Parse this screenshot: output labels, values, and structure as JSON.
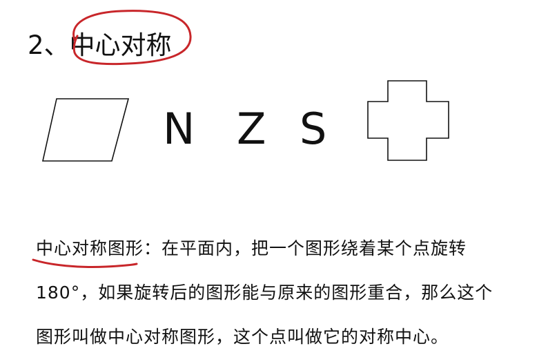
{
  "heading": {
    "number": "2、",
    "title": "中心对称"
  },
  "figures": {
    "letters": [
      "N",
      "Z",
      "S"
    ]
  },
  "definition": {
    "lines": [
      "中心对称图形：在平面内，把一个图形绕着某个点旋转",
      "180°，如果旋转后的图形能与原来的图形重合，那么这个",
      "图形叫做中心对称图形，这个点叫做它的对称中心。"
    ]
  },
  "colors": {
    "text": "#111111",
    "annotation": "#c8262a"
  }
}
